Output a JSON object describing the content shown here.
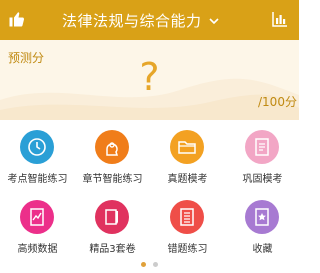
{
  "header": {
    "title": "法律法规与综合能力",
    "left_icon": "thumbs-up-icon",
    "dropdown_icon": "chevron-down-icon",
    "right_icon": "bar-chart-icon",
    "color": "#d9a117"
  },
  "score": {
    "label": "预测分",
    "value": "?",
    "max": "/100分"
  },
  "tiles": [
    {
      "label": "考点智能练习",
      "icon": "brain-clock-icon",
      "color": "#2a9fd6"
    },
    {
      "label": "章节智能练习",
      "icon": "brain-gear-icon",
      "color": "#f07d1a"
    },
    {
      "label": "真题模考",
      "icon": "folder-icon",
      "color": "#f3a122"
    },
    {
      "label": "巩固模考",
      "icon": "document-list-icon",
      "color": "#f2a6c5"
    },
    {
      "label": "高频数据",
      "icon": "trend-document-icon",
      "color": "#ec2f8a"
    },
    {
      "label": "精品3套卷",
      "icon": "book-pen-icon",
      "color": "#e0325f"
    },
    {
      "label": "错题练习",
      "icon": "error-list-icon",
      "color": "#ef4e48"
    },
    {
      "label": "收藏",
      "icon": "star-document-icon",
      "color": "#a77ad2"
    }
  ],
  "pager": {
    "pages": 2,
    "active": 1,
    "active_color": "#e0a13a",
    "inactive_color": "#cccccc"
  }
}
